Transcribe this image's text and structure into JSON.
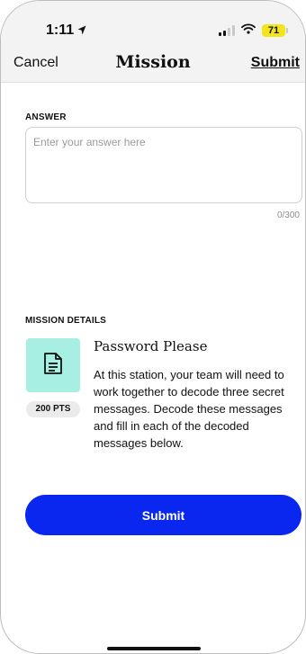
{
  "status_bar": {
    "time": "1:11",
    "battery": "71"
  },
  "nav": {
    "cancel_label": "Cancel",
    "title": "Mission",
    "submit_label": "Submit"
  },
  "answer": {
    "section_label": "ANSWER",
    "placeholder": "Enter your answer here",
    "value": "",
    "counter": "0/300"
  },
  "mission": {
    "section_label": "MISSION DETAILS",
    "icon": "document-icon",
    "points": "200 PTS",
    "title": "Password Please",
    "description": "At this station, your team will need to work together to decode three secret messages. Decode these messages and fill in each of the decoded messages below."
  },
  "primary_button": {
    "label": "Submit"
  },
  "colors": {
    "accent": "#0a27f0",
    "icon_tile": "#a8efe3",
    "battery": "#f2e51c"
  }
}
